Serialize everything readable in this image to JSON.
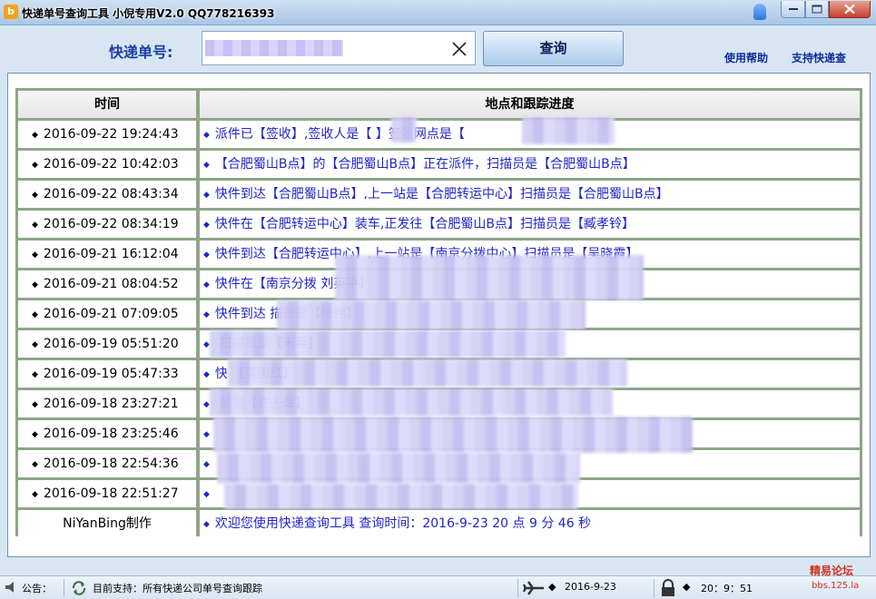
{
  "window": {
    "title": "快递单号查询工具 小倪专用V2.0    QQ778216393",
    "app_icon_glyph": "b"
  },
  "toolbar": {
    "tracking_label": "快递单号:",
    "tracking_value": "",
    "search_button": "查询",
    "help_link": "使用帮助",
    "support_link": "支持快递查"
  },
  "table": {
    "headers": {
      "time": "时间",
      "track": "地点和跟踪进度"
    },
    "rows": [
      {
        "time": "2016-09-22 19:24:43",
        "track": "派件已【签收】,签收人是【      】签收网点是【"
      },
      {
        "time": "2016-09-22 10:42:03",
        "track": "【合肥蜀山B点】的【合肥蜀山B点】正在派件，扫描员是【合肥蜀山B点】"
      },
      {
        "time": "2016-09-22 08:43:34",
        "track": "快件到达【合肥蜀山B点】,上一站是【合肥转运中心】扫描员是【合肥蜀山B点】"
      },
      {
        "time": "2016-09-22 08:34:19",
        "track": "快件在【合肥转运中心】装车,正发往【合肥蜀山B点】扫描员是【臧孝铃】"
      },
      {
        "time": "2016-09-21 16:12:04",
        "track": "快件到达【合肥转运中心】,上一站是【南京分拨中心】扫描员是【吴晓霞】"
      },
      {
        "time": "2016-09-21 08:04:52",
        "track": "快件在【南京分拨                                             刘英平】"
      },
      {
        "time": "2016-09-21 07:09:05",
        "track": "快件到达                                                       描员是【张伟】"
      },
      {
        "time": "2016-09-19 05:51:20",
        "track": "                                                               扫描员是【宋兵】"
      },
      {
        "time": "2016-09-19 05:47:33",
        "track": "快                                                                    【莫国红】"
      },
      {
        "time": "2016-09-18 23:27:21",
        "track": "                                                                   员是【许光辉】"
      },
      {
        "time": "2016-09-18 23:25:46",
        "track": ""
      },
      {
        "time": "2016-09-18 22:54:36",
        "track": ""
      },
      {
        "time": "2016-09-18 22:51:27",
        "track": ""
      }
    ],
    "footer": {
      "time": "NiYanBing制作",
      "track": "欢迎您使用快递查询工具  查询时间：2016-9-23   20 点 9 分 46 秒"
    }
  },
  "statusbar": {
    "notice_label": "公告：",
    "support_text": "目前支持：所有快递公司单号查询跟踪",
    "date": "2016-9-23",
    "time": "20：9：51",
    "watermark_line1": "精易论坛",
    "watermark_line2": "bbs.125.la"
  },
  "colors": {
    "accent_blue": "#1b3fa0",
    "track_text": "#2025c8",
    "grid_green": "#8ea58a",
    "mosaic": "#c8c3f2"
  },
  "icons": [
    "app-logo-icon",
    "lamp-icon",
    "minimize-icon",
    "maximize-icon",
    "close-icon",
    "clear-icon",
    "speaker-icon",
    "refresh-icon",
    "airplane-icon",
    "lock-icon"
  ]
}
